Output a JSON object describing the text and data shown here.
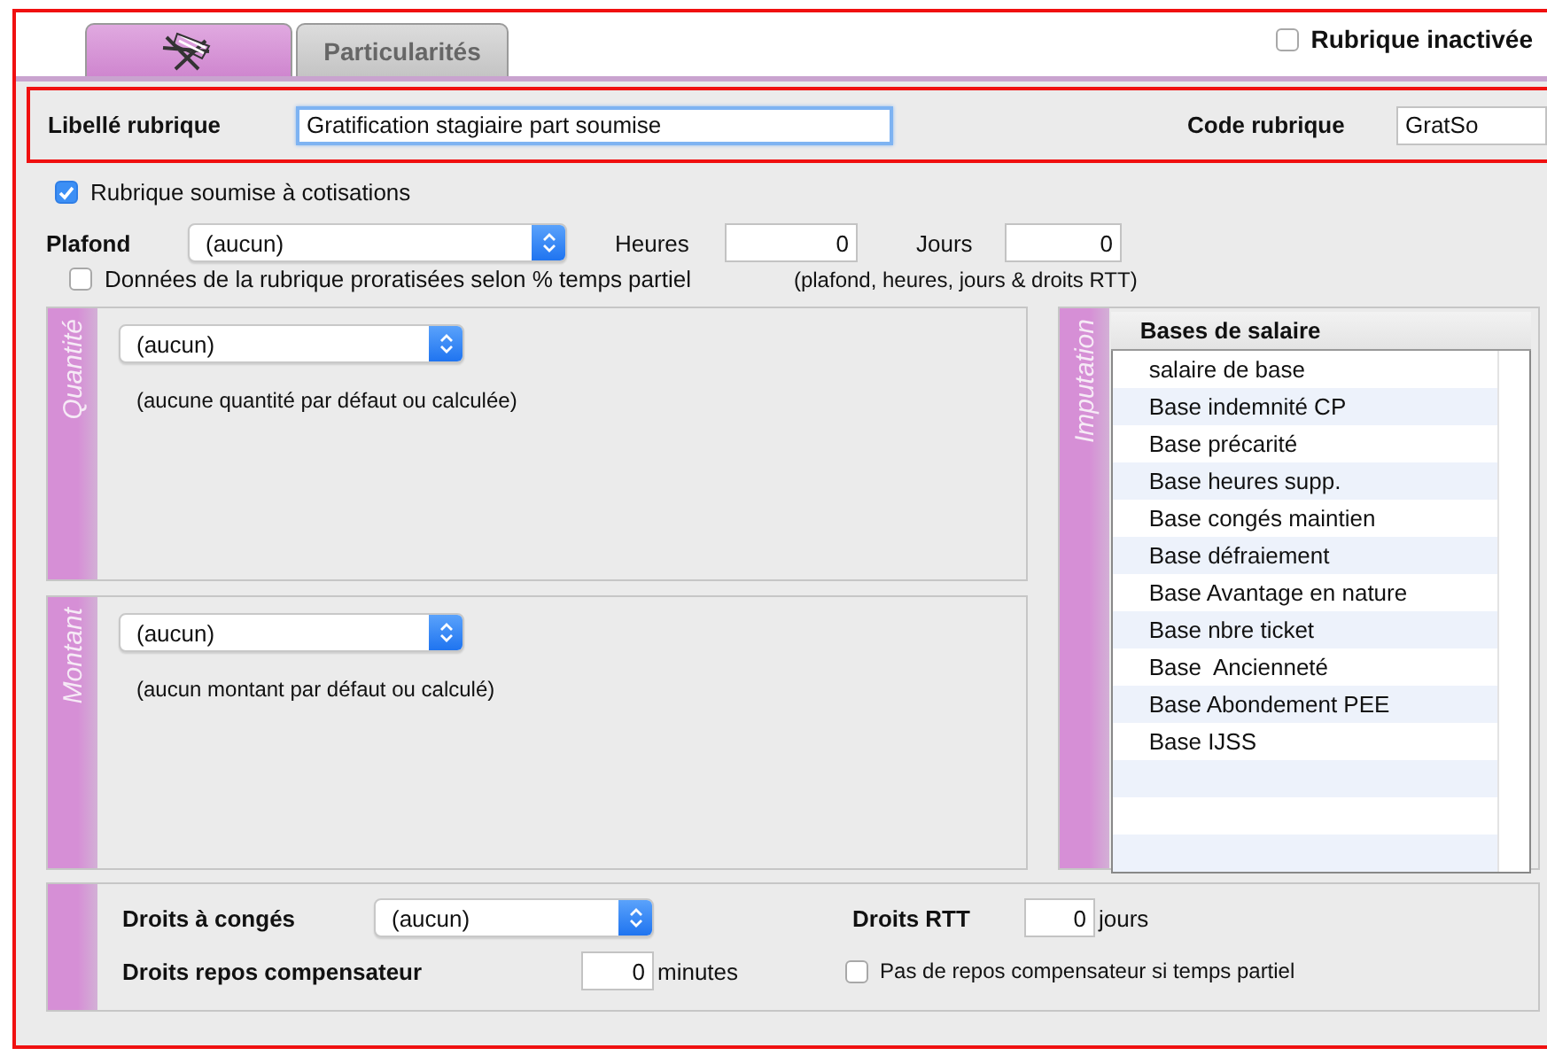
{
  "tabs": [
    {
      "kind": "icon",
      "selected": true
    },
    {
      "kind": "text",
      "label": "Particularités",
      "selected": false
    }
  ],
  "inactive_checkbox": {
    "label": "Rubrique inactivée",
    "checked": false
  },
  "libelle": {
    "label": "Libellé rubrique",
    "value": "Gratification stagiaire part soumise"
  },
  "code": {
    "label": "Code rubrique",
    "value": "GratSo"
  },
  "soumise_checkbox": {
    "label": "Rubrique soumise à cotisations",
    "checked": true
  },
  "plafond": {
    "label": "Plafond",
    "value": "(aucun)"
  },
  "heures": {
    "label": "Heures",
    "value": "0"
  },
  "jours": {
    "label": "Jours",
    "value": "0"
  },
  "prorata_checkbox": {
    "label": "Données de la rubrique proratisées selon % temps partiel",
    "checked": false
  },
  "prorata_note": "(plafond, heures, jours & droits RTT)",
  "quantite": {
    "title": "Quantité",
    "value": "(aucun)",
    "note": "(aucune quantité par défaut ou calculée)"
  },
  "montant": {
    "title": "Montant",
    "value": "(aucun)",
    "note": "(aucun montant par défaut ou calculé)"
  },
  "imputation": {
    "title": "Imputation",
    "column": "Bases de salaire",
    "rows": [
      "salaire de base",
      "Base indemnité CP",
      "Base précarité",
      "Base heures supp.",
      "Base congés maintien",
      "Base défraiement",
      "Base Avantage en nature",
      "Base nbre ticket",
      "Base  Ancienneté",
      "Base Abondement PEE",
      "Base IJSS"
    ]
  },
  "droits": {
    "conges": {
      "label": "Droits à congés",
      "value": "(aucun)"
    },
    "rtt": {
      "label": "Droits RTT",
      "value": "0",
      "unit": "jours"
    },
    "repos": {
      "label": "Droits repos compensateur",
      "value": "0",
      "unit": "minutes"
    },
    "pas_repos": {
      "label": "Pas de repos compensateur si temps partiel",
      "checked": false
    }
  }
}
